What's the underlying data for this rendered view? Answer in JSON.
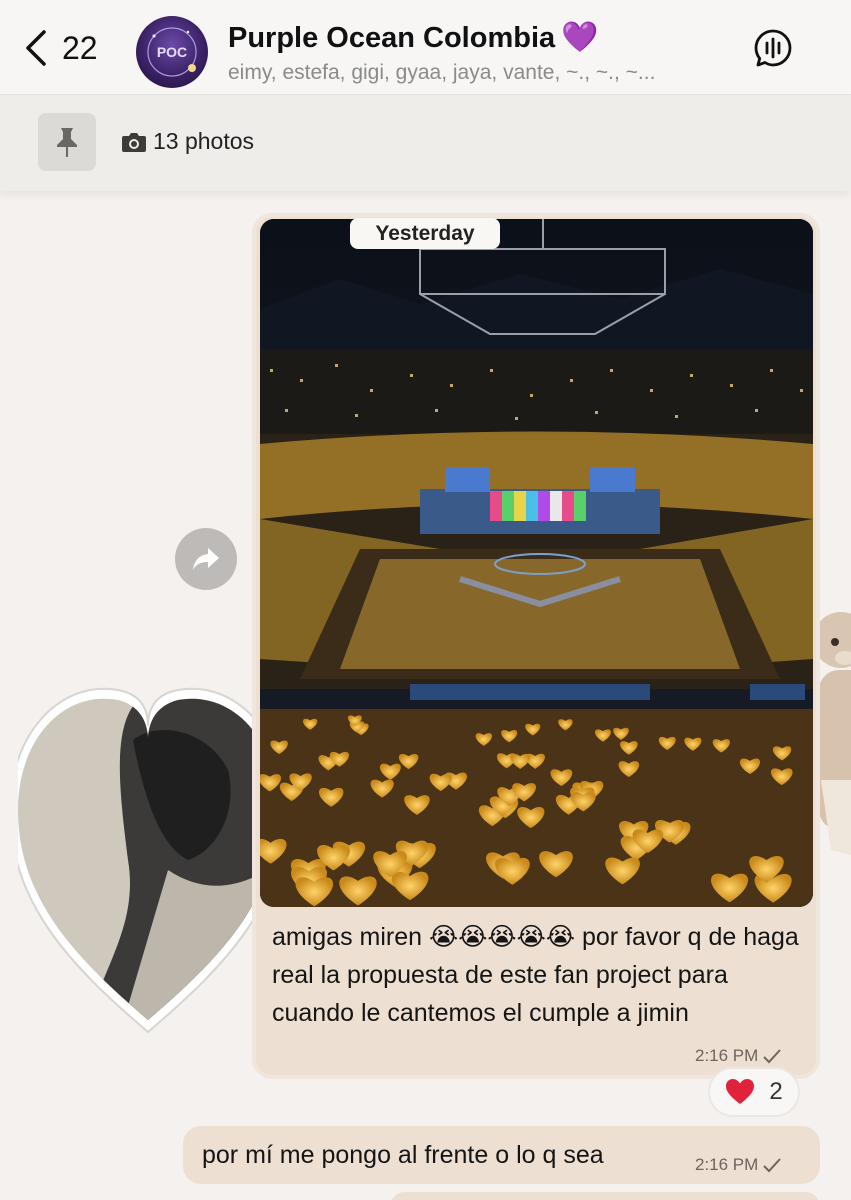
{
  "header": {
    "back_count": "22",
    "title": "Purple Ocean Colombia",
    "title_emoji": "💜",
    "members": "eimy, estefa, gigi, gyaa, jaya, vante, ~., ~., ~..."
  },
  "pinned": {
    "photos_label": "13 photos"
  },
  "messages": [
    {
      "date_label": "Yesterday",
      "text": "amigas miren 😭😭😭😭😭 por favor q de haga real la propuesta de este fan project para cuando le cantemos el cumple a jimin",
      "time": "2:16 PM",
      "reaction_emoji": "❤️",
      "reaction_count": "2"
    },
    {
      "text": "por mí me pongo al frente o lo q sea",
      "time": "2:16 PM"
    }
  ],
  "colors": {
    "bubble": "#ede0d2",
    "header_bg": "#f7f6f5",
    "accent_purple": "#9b3fe8",
    "reaction_red": "#e0223b"
  },
  "icons": {
    "back": "chevron-left-icon",
    "voice": "voice-chat-icon",
    "pin": "pin-icon",
    "camera": "camera-icon",
    "forward": "forward-icon",
    "check": "check-icon"
  }
}
